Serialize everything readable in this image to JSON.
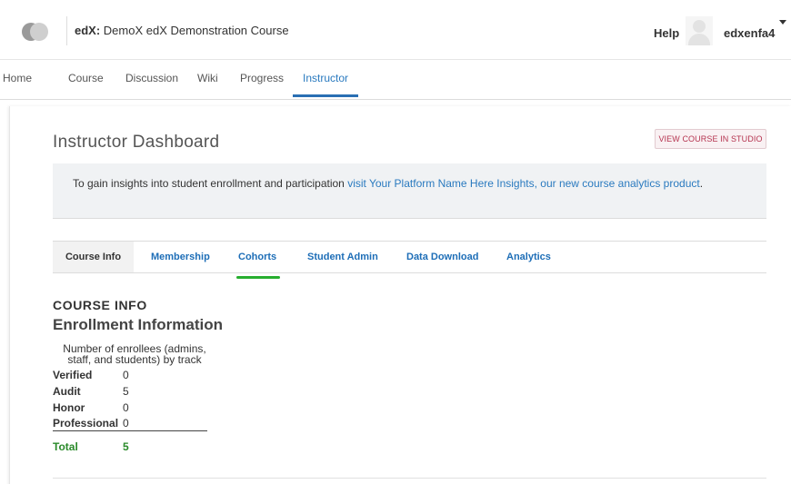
{
  "header": {
    "course_org": "edX:",
    "course_name": "DemoX edX Demonstration Course",
    "help_label": "Help",
    "username": "edxenfa4"
  },
  "course_nav": {
    "items": [
      {
        "label": "Home"
      },
      {
        "label": "Course"
      },
      {
        "label": "Discussion"
      },
      {
        "label": "Wiki"
      },
      {
        "label": "Progress"
      },
      {
        "label": "Instructor",
        "active": true
      }
    ]
  },
  "dashboard": {
    "title": "Instructor Dashboard",
    "studio_button": "VIEW COURSE IN STUDIO",
    "insights": {
      "text_before": "To gain insights into student enrollment and participation ",
      "link_text": "visit Your Platform Name Here Insights, our new course analytics product",
      "text_after": "."
    },
    "tabs": [
      {
        "label": "Course Info",
        "active": true
      },
      {
        "label": "Membership"
      },
      {
        "label": "Cohorts"
      },
      {
        "label": "Student Admin"
      },
      {
        "label": "Data Download"
      },
      {
        "label": "Analytics"
      }
    ]
  },
  "course_info": {
    "heading": "COURSE INFO",
    "subheading": "Enrollment Information",
    "caption": "Number of enrollees (admins, staff, and students) by track",
    "tracks": [
      {
        "label": "Verified",
        "value": "0"
      },
      {
        "label": "Audit",
        "value": "5"
      },
      {
        "label": "Honor",
        "value": "0"
      },
      {
        "label": "Professional",
        "value": "0"
      }
    ],
    "total": {
      "label": "Total",
      "value": "5"
    }
  },
  "colors": {
    "link_blue": "#2a7abf",
    "tab_blue": "#1e6eb7",
    "cohort_underline": "#27ae2f",
    "total_green": "#2a8a2a",
    "studio_pink": "#b5334f"
  }
}
